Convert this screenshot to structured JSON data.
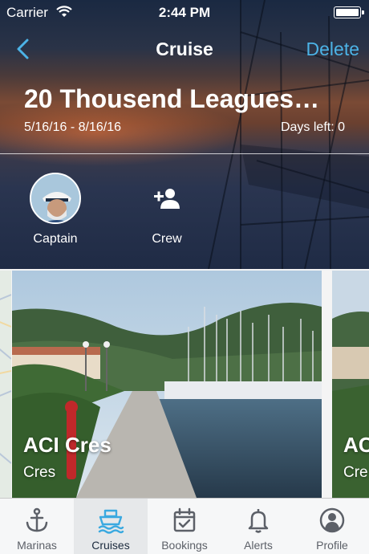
{
  "status_bar": {
    "carrier": "Carrier",
    "time": "2:44 PM"
  },
  "nav": {
    "title": "Cruise",
    "delete_label": "Delete",
    "back_icon": "chevron-left-icon"
  },
  "cruise": {
    "name": "20 Thousend Leagues…",
    "dates": "5/16/16 - 8/16/16",
    "days_left": "Days left: 0"
  },
  "people": {
    "captain_label": "Captain",
    "crew_label": "Crew"
  },
  "marinas": [
    {
      "name": "ACI Cres",
      "city": "Cres"
    },
    {
      "name": "ACI",
      "city": "Cre"
    }
  ],
  "tabs": [
    {
      "label": "Marinas",
      "icon": "anchor-icon"
    },
    {
      "label": "Cruises",
      "icon": "ship-icon",
      "active": true
    },
    {
      "label": "Bookings",
      "icon": "calendar-check-icon"
    },
    {
      "label": "Alerts",
      "icon": "bell-icon"
    },
    {
      "label": "Profile",
      "icon": "user-circle-icon"
    }
  ],
  "colors": {
    "accent": "#4cb3e6",
    "header_bg": "#1c2a44",
    "tabbar_bg": "#f6f7f8"
  }
}
